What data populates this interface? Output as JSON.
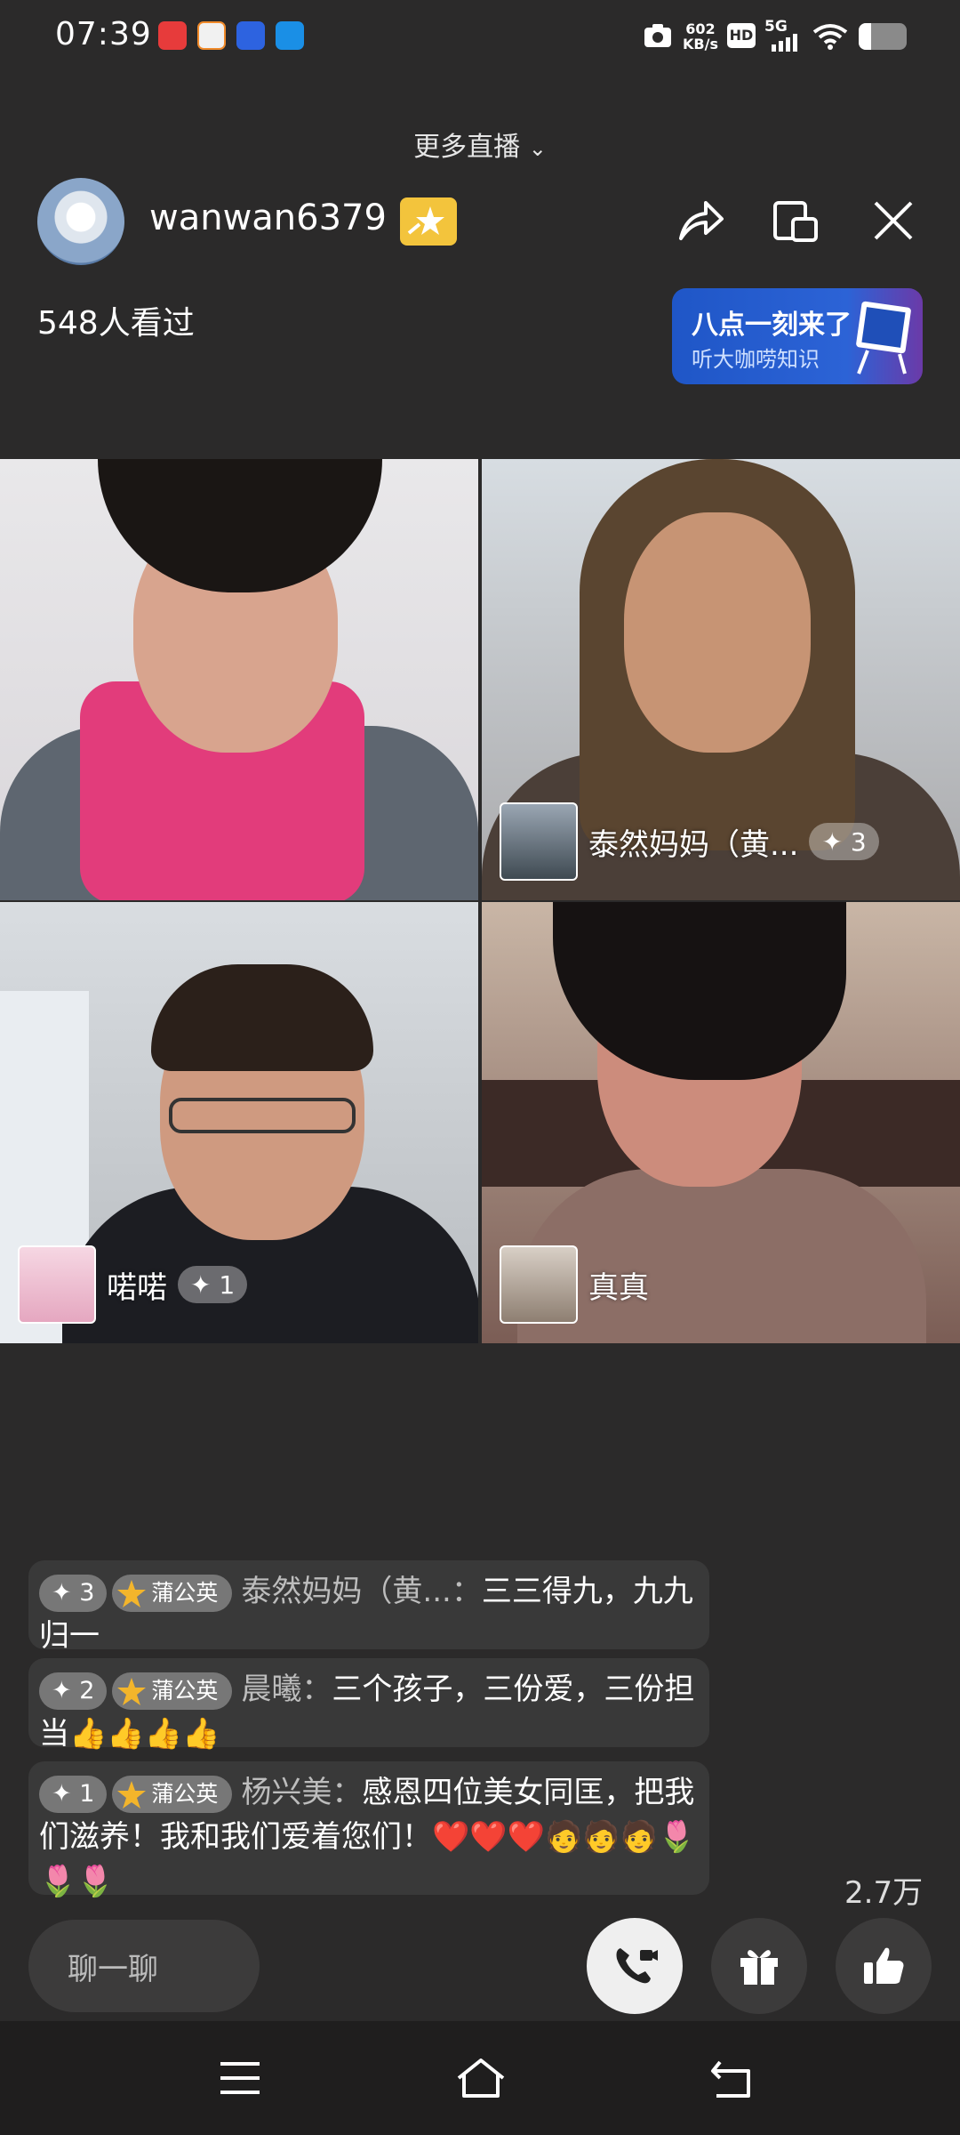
{
  "status_bar": {
    "time": "07:39",
    "net_speed_value": "602",
    "net_speed_unit": "KB/s",
    "hd": "HD",
    "network": "5G"
  },
  "header": {
    "more_live": "更多直播",
    "host_name": "wanwan6379",
    "viewers": "548人看过",
    "promo_title": "八点一刻来了",
    "promo_subtitle": "听大咖唠知识"
  },
  "tiles": [
    {
      "name": "",
      "count": ""
    },
    {
      "name": "泰然妈妈（黄...",
      "count": "3"
    },
    {
      "name": "喏喏",
      "count": "1"
    },
    {
      "name": "真真",
      "count": ""
    }
  ],
  "chat": [
    {
      "level": "3",
      "badge": "蒲公英",
      "user": "泰然妈妈（黄...：",
      "text": "三三得九，九九归一"
    },
    {
      "level": "2",
      "badge": "蒲公英",
      "user": "晨曦：",
      "text": "三个孩子，三份爱，三份担当👍👍👍👍"
    },
    {
      "level": "1",
      "badge": "蒲公英",
      "user": "杨兴美：",
      "text": "感恩四位美女同匡，把我们滋养！我和我们爱着您们！❤️❤️❤️🧑🧑🧑🌷🌷🌷"
    }
  ],
  "likes_count": "2.7万",
  "input_placeholder": "聊一聊",
  "colors": {
    "accent": "#f3c43c",
    "promo_blue": "#2c63d6",
    "background": "#2b2a2a"
  }
}
